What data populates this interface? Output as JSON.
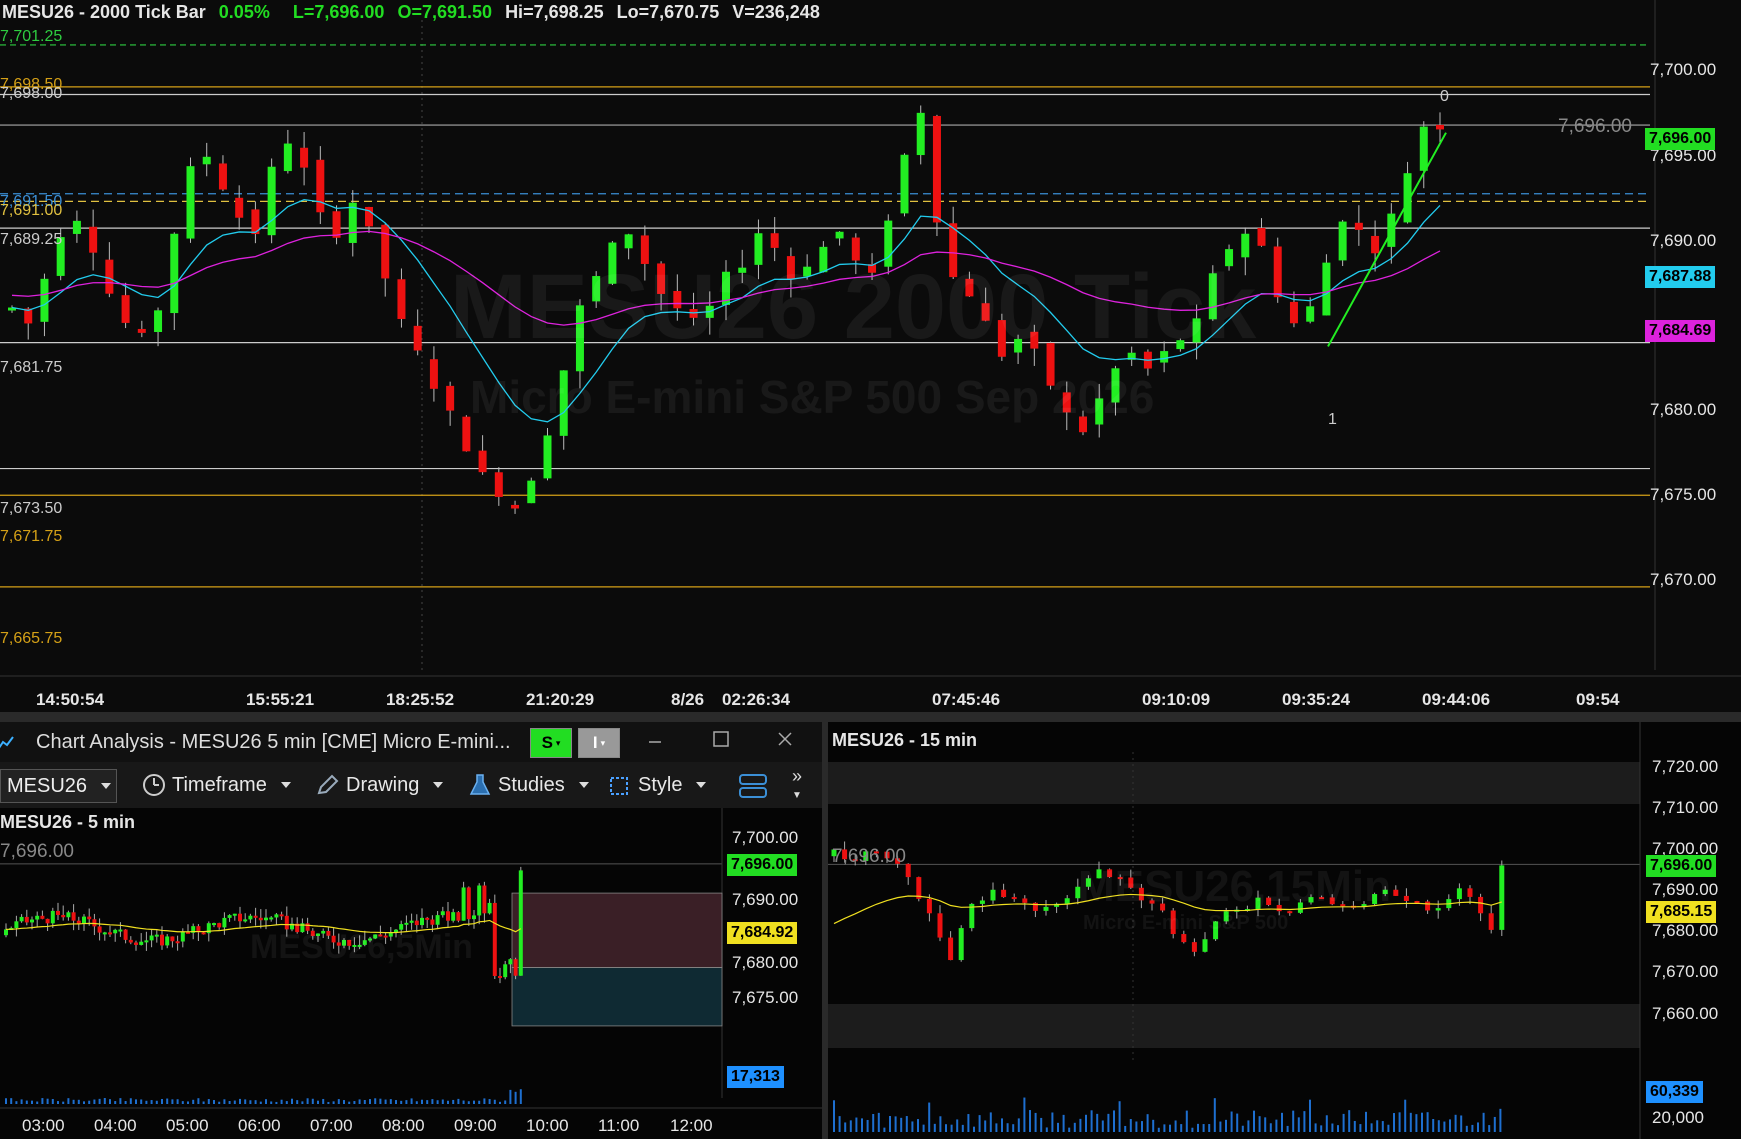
{
  "main": {
    "header": {
      "symbol": "MESU26 - 2000 Tick Bar",
      "change": "0.05%",
      "last": "L=7,696.00",
      "open": "O=7,691.50",
      "high": "Hi=7,698.25",
      "low": "Lo=7,670.75",
      "volume": "V=236,248"
    },
    "watermark": "MESU26 2000 Tick",
    "watermark_sub": "Micro E-mini S&P 500 Sep 2026",
    "levels": [
      {
        "label": "7,701.25",
        "color": "#2ecc40"
      },
      {
        "label": "7,698.50",
        "color": "#d4a017"
      },
      {
        "label": "7,698.00",
        "color": "#cccccc"
      },
      {
        "label": "7,691.50",
        "color": "#3b8fd6"
      },
      {
        "label": "7,691.00",
        "color": "#e0c040"
      },
      {
        "label": "7,689.25",
        "color": "#cccccc"
      },
      {
        "label": "7,681.75",
        "color": "#cccccc"
      },
      {
        "label": "7,673.50",
        "color": "#cccccc"
      },
      {
        "label": "7,671.75",
        "color": "#d4a017"
      },
      {
        "label": "7,665.75",
        "color": "#d4a017"
      }
    ],
    "price_axis": [
      "7,700.00",
      "7,695.00",
      "7,690.00",
      "7,680.00",
      "7,675.00",
      "7,670.00"
    ],
    "last_price_ref": "7,696.00",
    "tags": [
      {
        "label": "7,696.00",
        "bg": "#22dd22"
      },
      {
        "label": "7,687.88",
        "bg": "#22ccee"
      },
      {
        "label": "7,684.69",
        "bg": "#dd22dd"
      }
    ],
    "time_axis": [
      "14:50:54",
      "15:55:21",
      "18:25:52",
      "21:20:29",
      "8/26",
      "02:26:34",
      "07:45:46",
      "09:10:09",
      "09:35:24",
      "09:44:06",
      "09:54"
    ],
    "annotations": {
      "zero": "0",
      "one": "1"
    }
  },
  "analysis_window": {
    "title": "Chart Analysis - MESU26 5 min [CME] Micro E-mini...",
    "s_button": "S",
    "i_button": "I",
    "symbol_select": "MESU26",
    "toolbar": {
      "timeframe": "Timeframe",
      "drawing": "Drawing",
      "studies": "Studies",
      "style": "Style"
    },
    "chart_title": "MESU26 - 5 min",
    "watermark": "MESU26,5Min",
    "last_price_ref": "7,696.00",
    "price_axis": [
      "7,700.00",
      "7,690.00",
      "7,680.00",
      "7,675.00"
    ],
    "tags": [
      {
        "label": "7,696.00",
        "bg": "#22dd22"
      },
      {
        "label": "7,684.92",
        "bg": "#f0e020"
      }
    ],
    "volume_tag": {
      "label": "17,313",
      "bg": "#1e90ff"
    },
    "time_axis": [
      "03:00",
      "04:00",
      "05:00",
      "06:00",
      "07:00",
      "08:00",
      "09:00",
      "10:00",
      "11:00",
      "12:00"
    ]
  },
  "chart_15min": {
    "title": "MESU26 - 15 min",
    "watermark": "MESU26,15Min",
    "watermark_sub": "Micro E-mini S&P 500",
    "last_price_ref": "7,696.00",
    "price_axis": [
      "7,720.00",
      "7,710.00",
      "7,700.00",
      "7,690.00",
      "7,680.00",
      "7,670.00",
      "7,660.00"
    ],
    "tags": [
      {
        "label": "7,696.00",
        "bg": "#22dd22"
      },
      {
        "label": "7,685.15",
        "bg": "#f0e020"
      }
    ],
    "volume_tag": {
      "label": "60,339",
      "bg": "#1e90ff"
    },
    "volume_axis": "20,000"
  }
}
